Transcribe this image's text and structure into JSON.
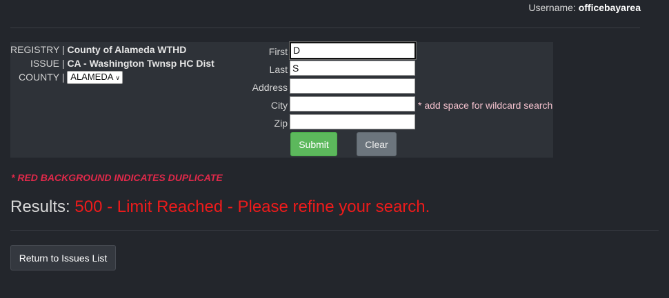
{
  "header": {
    "username_label": "Username:",
    "username_value": "officebayarea"
  },
  "info": {
    "registry_label": "REGISTRY |",
    "registry_value": "County of Alameda WTHD",
    "issue_label": "ISSUE |",
    "issue_value": "CA - Washington Twnsp HC Dist",
    "county_label": "COUNTY |",
    "county_selected": "ALAMEDA"
  },
  "search": {
    "first_label": "First",
    "first_value": "D",
    "last_label": "Last",
    "last_value": "S",
    "address_label": "Address",
    "address_value": "",
    "city_label": "City",
    "city_value": "",
    "zip_label": "Zip",
    "zip_value": "",
    "wildcard_note": "* add space for wildcard search",
    "submit_label": "Submit",
    "clear_label": "Clear"
  },
  "notes": {
    "duplicate_note": "* RED BACKGROUND INDICATES DUPLICATE"
  },
  "results": {
    "label": "Results:",
    "value": "500 - Limit Reached - Please refine your search."
  },
  "footer": {
    "return_label": "Return to Issues List"
  },
  "colors": {
    "background": "#23262c",
    "panel": "#2e3238",
    "submit": "#5cb85c",
    "clear": "#6c757d",
    "duplicate_note": "#e0294a",
    "results_value": "#ee1b1b",
    "wildcard_note": "#f3c1cd"
  }
}
